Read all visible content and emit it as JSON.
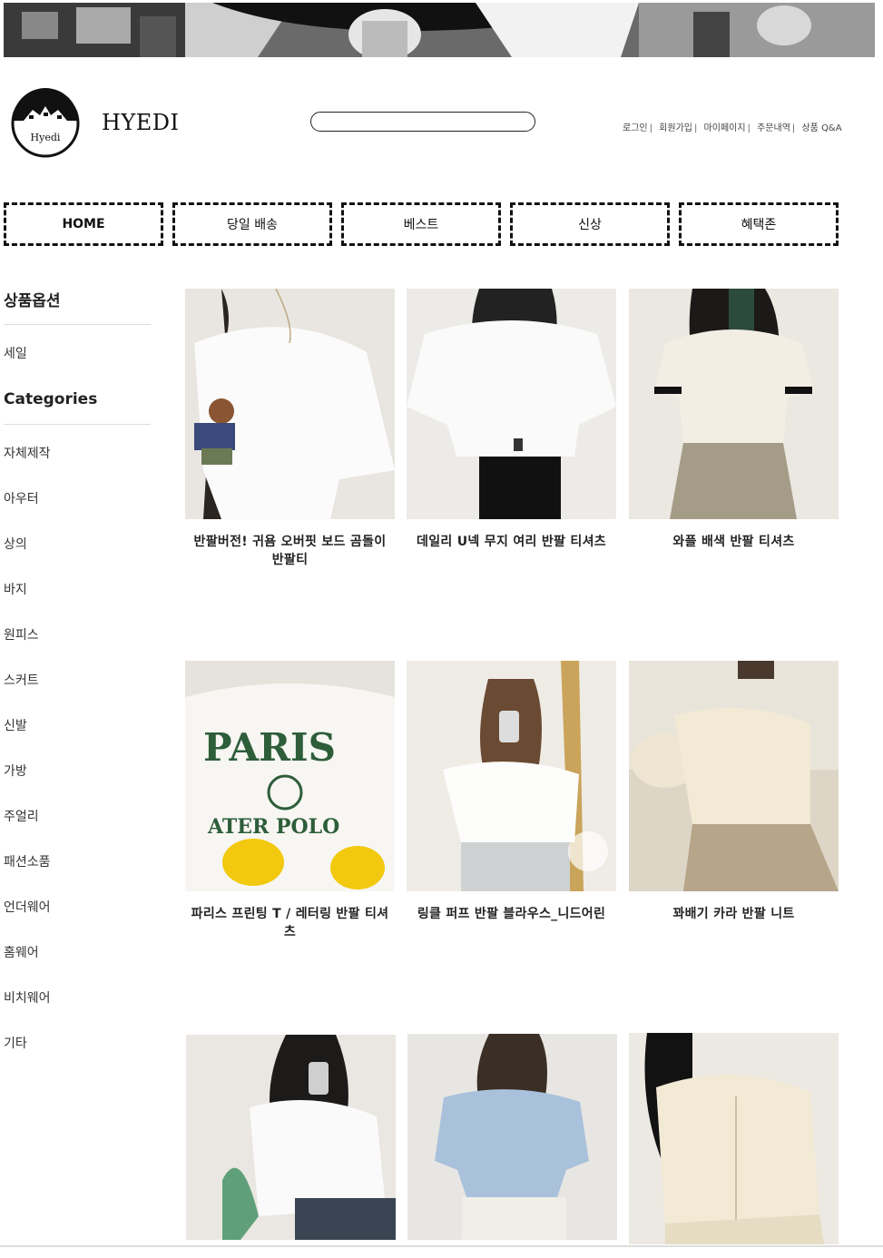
{
  "header": {
    "brand": "HYEDI",
    "logo_text": "Hyedi",
    "search_placeholder": ""
  },
  "topnav": [
    {
      "label": "로그인"
    },
    {
      "label": "회원가입"
    },
    {
      "label": "마이페이지"
    },
    {
      "label": "주문내역"
    },
    {
      "label": "상품 Q&A"
    }
  ],
  "mainnav": [
    {
      "label": "HOME"
    },
    {
      "label": "당일 배송"
    },
    {
      "label": "베스트"
    },
    {
      "label": "신상"
    },
    {
      "label": "혜택존"
    }
  ],
  "sidebar": {
    "options_title": "상품옵션",
    "options": [
      "세일"
    ],
    "categories_title": "Categories",
    "categories": [
      "자체제작",
      "아우터",
      "상의",
      "바지",
      "원피스",
      "스커트",
      "신발",
      "가방",
      "주얼리",
      "패션소품",
      "언더웨어",
      "홈웨어",
      "비치웨어",
      "기타"
    ]
  },
  "products": [
    {
      "name": "반팔버전! 귀욤 오버핏 보드 곰돌이 반팔티"
    },
    {
      "name": "데일리 U넥 무지 여리 반팔 티셔츠"
    },
    {
      "name": "와플 배색 반팔 티셔츠"
    },
    {
      "name": "파리스 프린팅 T / 레터링 반팔 티셔츠"
    },
    {
      "name": "링클 퍼프 반팔 블라우스_니드어린"
    },
    {
      "name": "꽈배기 카라 반팔 니트"
    },
    {
      "name": ""
    },
    {
      "name": ""
    },
    {
      "name": ""
    }
  ],
  "colors": {
    "accent": "#111111",
    "divider": "#dddddd"
  }
}
